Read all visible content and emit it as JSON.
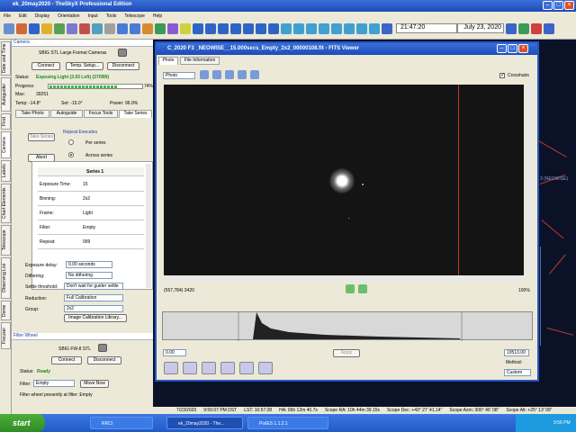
{
  "app": {
    "title": "ek_20may2020 - TheSkyX Professional Edition",
    "menu": [
      "File",
      "Edit",
      "Display",
      "Orientation",
      "Input",
      "Tools",
      "Telescope",
      "Help"
    ],
    "time": "21:47:20",
    "date": "July 23, 2020"
  },
  "vtabs": [
    "Date and Time",
    "Autoguider",
    "Find",
    "Camera",
    "Labels",
    "Chart Elements",
    "Telescope",
    "Observing List",
    "Dome",
    "Focuser"
  ],
  "camera": {
    "section_title": "Camera",
    "model": "SBIG STL Large Format Cameras",
    "connect": "Connect",
    "temp_setup": "Temp. Setup...",
    "disconnect": "Disconnect",
    "status_label": "Status:",
    "status_value": "Exposing Light (3.93 Left) (37/999)",
    "progress_label": "Progress:",
    "progress_pct": "74%",
    "progress_value": 0.74,
    "max_label": "Max:",
    "max_value": "39251",
    "temp_label": "Temp: -14.8°",
    "set_label": "Set: -15.0°",
    "power_label": "Power: 96.0%",
    "tabs": [
      "Take Photo",
      "Autoguide",
      "Focus Tools",
      "Take Series"
    ],
    "active_tab": "Take Series",
    "take_series_btn": "Take Series",
    "repeat_executes": "Repeat Executes",
    "per_series": "Per series",
    "across_series": "Across series",
    "abort": "Abort",
    "series_header": "Series 1",
    "series_rows": [
      {
        "label": "Exposure Time:",
        "value": "15"
      },
      {
        "label": "Binning:",
        "value": "2x2"
      },
      {
        "label": "Frame:",
        "value": "Light"
      },
      {
        "label": "Filter:",
        "value": "Empty"
      },
      {
        "label": "Repeat:",
        "value": "999"
      }
    ],
    "exposure_delay_label": "Exposure delay:",
    "exposure_delay_value": "0.00 seconds",
    "dithering_label": "Dithering:",
    "dithering_value": "No dithering",
    "settle_label": "Settle threshold:",
    "settle_value": "Don't wait for guider settle",
    "reduction_label": "Reduction:",
    "reduction_value": "Full Calibration",
    "group_label": "Group:",
    "group_value": "2x2",
    "calib_library": "Image Calibration Library..."
  },
  "filter_wheel": {
    "section_title": "Filter Wheel",
    "model": "SBIG FW-8 STL",
    "connect": "Connect",
    "disconnect": "Disconnect",
    "status_label": "Status:",
    "status_value": "Ready",
    "filter_label": "Filter:",
    "filter_value": "Empty",
    "move_now": "Move Now",
    "presently": "Filter wheel presently at filter: Empty"
  },
  "fits": {
    "title": "C_2020 F3 _NEOWISE__15.000secs_Empty_2x2_00000108.fit - FITS Viewer",
    "tabs": [
      "Photo",
      "File Information"
    ],
    "active_tab": "Photo",
    "view_select": "Photo",
    "crosshairs": "Crosshairs",
    "coords": "(557,784) 3420",
    "zoom": "100%",
    "hist_min": "0.00",
    "hist_max": "19513.00",
    "apply": "Apply",
    "method_label": "Method:",
    "method_value": "Custom"
  },
  "sky": {
    "object_label": "3 (NEOWISE)"
  },
  "statusbar": [
    "7/23/2020",
    "9:56:07 PM DST",
    "LST: 16:57:28",
    "HA: 06h 12m 40.7s",
    "Scope RA: 10h 44m 39.15s",
    "Scope Dec: +43° 27' 41.14\"",
    "Scope Azm: 306° 46' 08\"",
    "Scope Alt: +25° 13' 09\""
  ],
  "taskbar": {
    "start": "start",
    "tasks": [
      "RRCI",
      "ek_20may2020 - The...",
      "PixIES 1.1.2.1"
    ],
    "clock": "9:56 PM"
  },
  "colors": {
    "accent": "#1c4bb8",
    "progress": "#3fb844",
    "status_ok": "#1b8a1b"
  }
}
